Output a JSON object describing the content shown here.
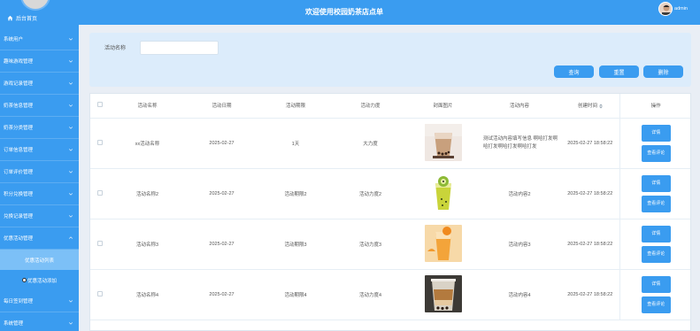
{
  "sidebar": {
    "home_label": "后台首页",
    "items": [
      {
        "label": "系统用户"
      },
      {
        "label": "趣味游戏管理"
      },
      {
        "label": "游戏记录管理"
      },
      {
        "label": "奶茶信息管理"
      },
      {
        "label": "奶茶分类管理"
      },
      {
        "label": "订单信息管理"
      },
      {
        "label": "订单评价管理"
      },
      {
        "label": "积分兑换管理"
      },
      {
        "label": "兑换记录管理"
      },
      {
        "label": "优惠活动管理"
      }
    ],
    "sub_items": [
      {
        "label": "优惠活动列表"
      },
      {
        "label": "优惠活动添加"
      }
    ],
    "items_after": [
      {
        "label": "每日签到管理"
      },
      {
        "label": "系统管理"
      }
    ]
  },
  "header": {
    "title": "欢迎使用校园奶茶店点单",
    "username": "admin"
  },
  "search": {
    "label": "活动名称",
    "value": "",
    "placeholder": "",
    "query_label": "查询",
    "reset_label": "重置",
    "delete_label": "删除"
  },
  "table": {
    "columns": [
      "活动名称",
      "活动日期",
      "活动期限",
      "活动力度",
      "封面图片",
      "活动内容",
      "创建时间",
      "操作"
    ],
    "detail_label": "详情",
    "review_label": "查看评论",
    "rows": [
      {
        "name": "xx活动名称",
        "date": "2025-02-27",
        "period": "1天",
        "strength": "大力度",
        "content": "测试活动内容填写信息 啊哈打发啊哈打发啊哈打发啊哈打发",
        "created": "2025-02-27 18:58:22",
        "image": "milktea-cup"
      },
      {
        "name": "活动名称2",
        "date": "2025-02-27",
        "period": "活动期限2",
        "strength": "活动力度2",
        "content": "活动内容2",
        "created": "2025-02-27 18:58:22",
        "image": "kiwi-drink"
      },
      {
        "name": "活动名称3",
        "date": "2025-02-27",
        "period": "活动期限3",
        "strength": "活动力度3",
        "content": "活动内容3",
        "created": "2025-02-27 18:58:22",
        "image": "orange-drink"
      },
      {
        "name": "活动名称4",
        "date": "2025-02-27",
        "period": "活动期限4",
        "strength": "活动力度4",
        "content": "活动内容4",
        "created": "2025-02-27 18:58:22",
        "image": "boba-tea"
      }
    ]
  },
  "colors": {
    "primary": "#3a9cf0",
    "search_bg": "#dcecfb",
    "active_sub": "#7cc0f7"
  }
}
